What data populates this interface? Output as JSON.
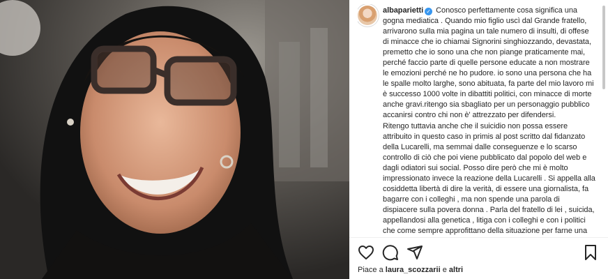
{
  "post": {
    "username": "albaparietti",
    "verified_glyph": "✓",
    "caption": "Conosco perfettamente cosa significa una gogna mediatica . Quando mio figlio uscì dal Grande fratello, arrivarono sulla mia pagina un tale numero di insulti, di offese di minacce che io chiamai Signorini singhiozzando, devastata, premetto che io sono una che non piange praticamente mai, perché faccio parte di quelle persone educate a non mostrare le emozioni perché ne ho pudore. io sono una persona che ha le spalle molto larghe, sono abituata, fa parte del mio lavoro mi è successo 1000 volte in dibattiti politici, con minacce di morte anche gravi.ritengo sia sbagliato per un personaggio pubblico accanirsi contro chi non è' attrezzato per difendersi.\nRitengo tuttavia anche che il suicidio non possa essere attribuito in questo caso in primis al post scritto dal fidanzato della Lucarelli, ma semmai dalle conseguenze e lo scarso controllo di ciò che poi viene pubblicato dal popolo del web e dagli odiatori sui social. Posso dire però che mi è molto impressionato invece la reazione della Lucarelli . Si appella alla cosiddetta libertà di dire la verità, di essere una giornalista, fa bagarre con i colleghi , ma non spende una parola di dispiacere sulla povera donna . Parla del fratello di lei , suicida, appellandosi alla genetica , litiga con i colleghi e con i politici che come sempre approfittano della situazione per farne una questione politica e non morale, generale , senza pensare invece a una legge che tuteli tutti nessuno escluso da massacri mediatici , oltraggiosi .\nMa , se io investo e uccido una persona con la mia auto, il mio"
  },
  "likes": {
    "prefix": "Piace a",
    "user": "laura_scozzarii",
    "conj": "e",
    "others": "altri"
  },
  "icons": [
    "heart-icon",
    "comment-icon",
    "share-icon",
    "bookmark-icon"
  ]
}
